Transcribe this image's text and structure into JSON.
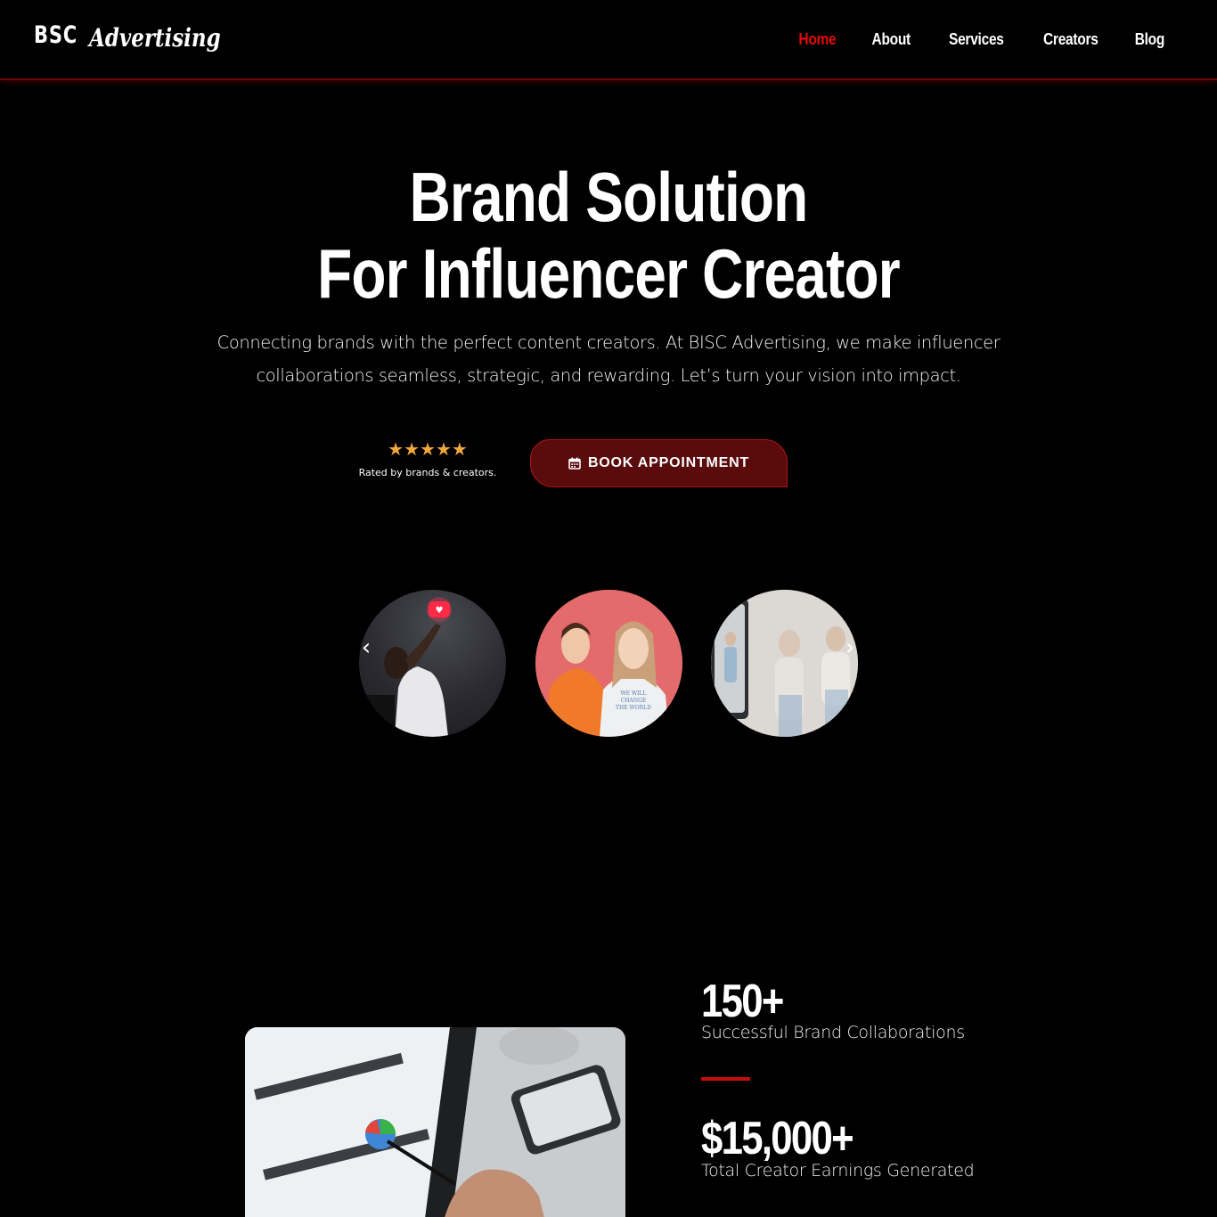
{
  "header": {
    "logo_mark": "BSC",
    "logo_text": "Advertising",
    "nav": [
      {
        "label": "Home",
        "active": true
      },
      {
        "label": "About",
        "active": false
      },
      {
        "label": "Services",
        "active": false
      },
      {
        "label": "Creators",
        "active": false
      },
      {
        "label": "Blog",
        "active": false
      }
    ]
  },
  "hero": {
    "title_line1": "Brand Solution",
    "title_line2": "For Influencer Creator",
    "subtitle": "Connecting brands with the perfect content creators. At BISC Advertising, we make influencer collaborations seamless, strategic, and rewarding. Let’s turn your vision into impact.",
    "rating": {
      "stars": 5,
      "stars_glyphs": "★★★★★",
      "label": "Rated by brands & creators."
    },
    "cta": {
      "label": "BOOK APPOINTMENT",
      "icon": "calendar-icon"
    }
  },
  "carousel": {
    "images": [
      "person-with-heart-notification",
      "two-young-creators",
      "friends-filmed-on-phone"
    ],
    "prev_icon": "chevron-left-icon",
    "next_icon": "chevron-right-icon"
  },
  "stats": [
    {
      "value": "150+",
      "label": "Successful Brand Collaborations"
    },
    {
      "value": "$15,000+",
      "label": "Total Creator Earnings Generated"
    }
  ],
  "colors": {
    "accent": "#e30b0b",
    "button_bg": "#5a0b0b",
    "star": "#f4a640",
    "background": "#000000"
  }
}
